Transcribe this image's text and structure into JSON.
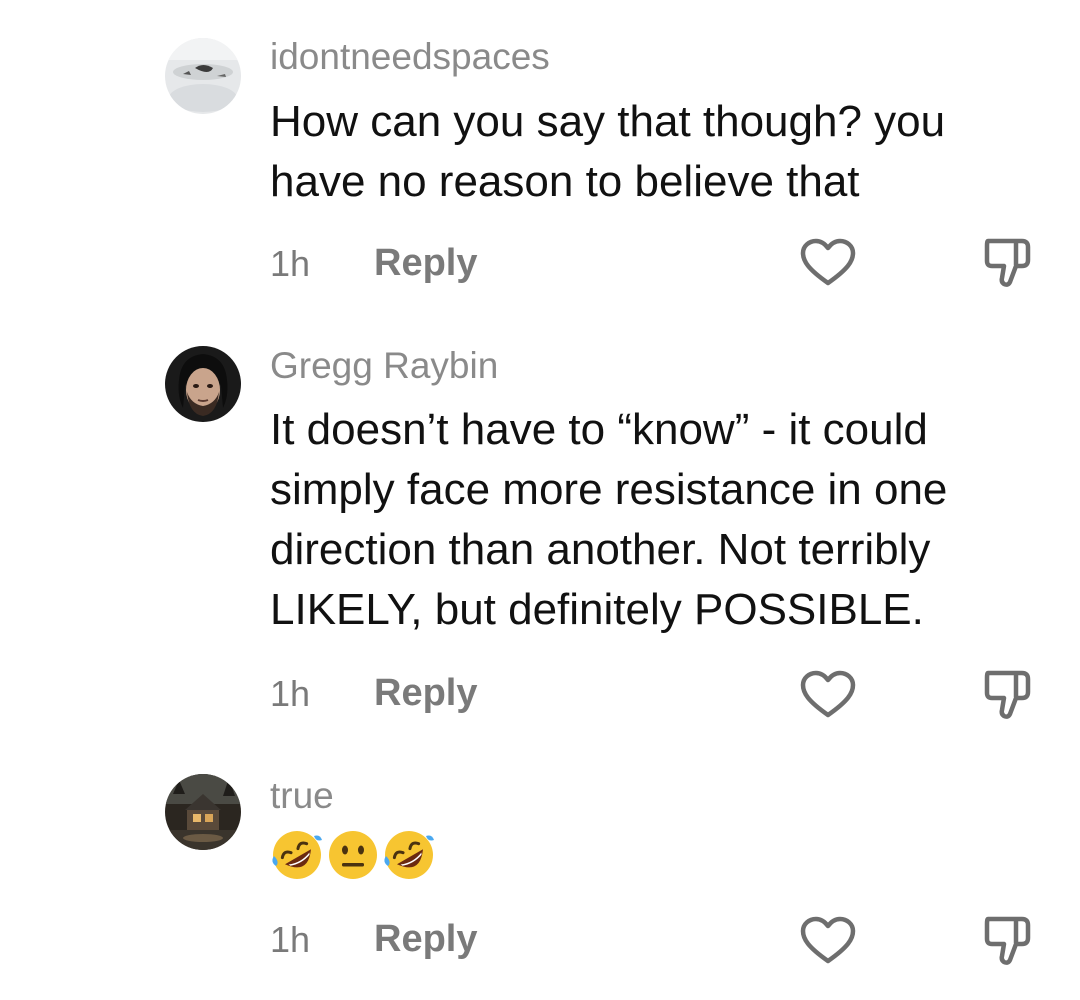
{
  "comments": [
    {
      "username": "idontneedspaces",
      "lines": [
        "How can you say that though? you",
        "have no reason to believe that"
      ],
      "time": "1h",
      "reply_label": "Reply"
    },
    {
      "username": "Gregg Raybin",
      "lines": [
        "It doesn’t have to “know” - it could",
        "simply face more resistance in one",
        "direction than another. Not terribly",
        "LIKELY, but definitely POSSIBLE."
      ],
      "time": "1h",
      "reply_label": "Reply"
    },
    {
      "username": "true",
      "emojis": [
        "rolling-on-floor-laughing",
        "neutral-face",
        "rolling-on-floor-laughing"
      ],
      "time": "1h",
      "reply_label": "Reply"
    }
  ],
  "colors": {
    "username": "#8a8a8a",
    "body_text": "#111111",
    "meta_text": "#7a7a7a",
    "icon_stroke": "#6e6e6e",
    "emoji_yellow": "#f7c531"
  }
}
